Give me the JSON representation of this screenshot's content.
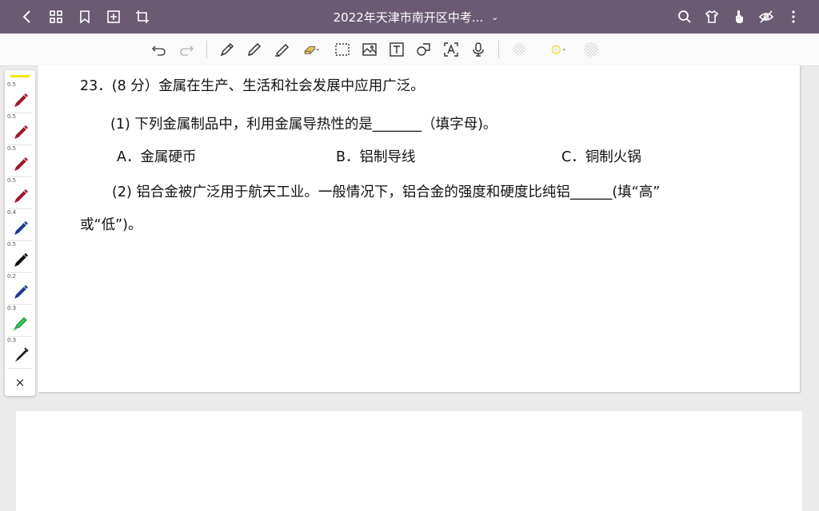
{
  "header": {
    "title": "2022年天津市南开区中考...",
    "title_chevron": "⌄"
  },
  "palette": {
    "sizes": [
      "0.5",
      "0.5",
      "0.5",
      "0.5",
      "0.4",
      "0.5",
      "0.2",
      "0.3",
      "0.3"
    ],
    "close": "×"
  },
  "question": {
    "stem": "23．(8 分）金属在生产、生活和社会发展中应用广泛。",
    "part1": "(1)  下列金属制品中，利用金属导热性的是_______（填字母)。",
    "option_a": "A．金属硬币",
    "option_b": "B．铝制导线",
    "option_c": "C．铜制火锅",
    "part2": "(2)  铝合金被广泛用于航天工业。一般情况下，铝合金的强度和硬度比纯铝______(填“高”",
    "part2_cont": "或“低”)。"
  },
  "colors": {
    "titlebar": "#6a5b73",
    "highlight": "#f3e600"
  }
}
